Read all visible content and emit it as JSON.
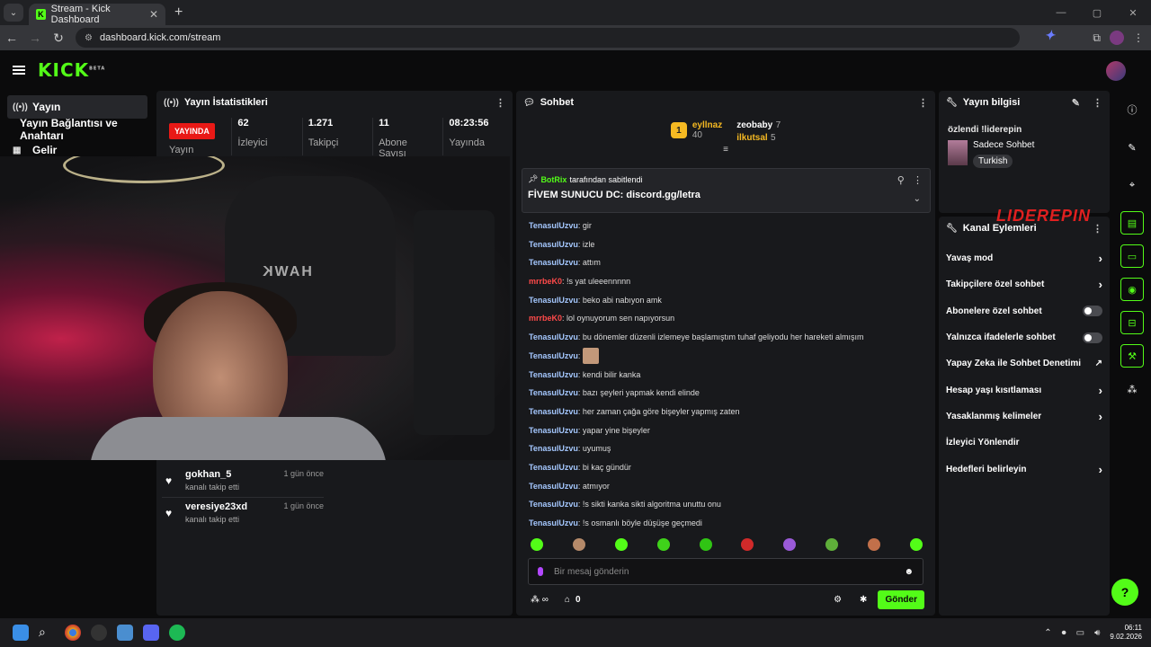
{
  "browser": {
    "tab_title": "Stream - Kick Dashboard",
    "url": "dashboard.kick.com/stream"
  },
  "kick": {
    "logo": "KICK",
    "logo_badge": "BETA"
  },
  "leftnav": {
    "items": [
      {
        "label": "Yayın",
        "icon": "broadcast-icon"
      },
      {
        "label": "Yayın Bağlantısı ve Anahtarı"
      },
      {
        "label": "Gelir",
        "icon": "chart-icon"
      }
    ]
  },
  "stats": {
    "title": "Yayın İstatistikleri",
    "live_badge": "YAYINDA",
    "status_label": "Yayın",
    "items": [
      {
        "value": "62",
        "label": "İzleyici"
      },
      {
        "value": "1.271",
        "label": "Takipçi"
      },
      {
        "value": "11",
        "label": "Abone Sayısı"
      },
      {
        "value": "08:23:56",
        "label": "Yayında"
      }
    ]
  },
  "followers": [
    {
      "name": "gokhan_5",
      "action": "kanalı takip etti",
      "time": "1 gün önce"
    },
    {
      "name": "veresiye23xd",
      "action": "kanalı takip etti",
      "time": "1 gün önce"
    }
  ],
  "chat": {
    "title": "Sohbet",
    "leaderboard": [
      {
        "rank": "1",
        "name": "eyllnaz",
        "count": "40"
      },
      {
        "name": "zeobaby",
        "count": "7"
      },
      {
        "name": "ilkutsal",
        "count": "5"
      }
    ],
    "pinned": {
      "by_name": "BotRix",
      "by_suffix": "tarafından sabitlendi",
      "message": "FİVEM SUNUCU DC: discord.gg/letra"
    },
    "messages": [
      {
        "user": "TenasulUzvu",
        "text": "gir"
      },
      {
        "user": "TenasulUzvu",
        "text": "izle"
      },
      {
        "user": "TenasulUzvu",
        "text": "attım"
      },
      {
        "user": "mrrbeK0",
        "text": "!s yat uleeennnnn",
        "red": true
      },
      {
        "user": "TenasulUzvu",
        "text": "beko abi nabıyon amk"
      },
      {
        "user": "mrrbeK0",
        "text": "lol oynuyorum sen napıyorsun",
        "red": true
      },
      {
        "user": "TenasulUzvu",
        "text": "bu dönemler düzenli izlemeye başlamıştım tuhaf geliyodu her hareketi almışım"
      },
      {
        "user": "TenasulUzvu",
        "text": "",
        "emote": true
      },
      {
        "user": "TenasulUzvu",
        "text": "kendi bilir kanka"
      },
      {
        "user": "TenasulUzvu",
        "text": "bazı şeyleri yapmak kendi elinde"
      },
      {
        "user": "TenasulUzvu",
        "text": "her zaman çağa göre bişeyler yapmış zaten"
      },
      {
        "user": "TenasulUzvu",
        "text": "yapar yine bişeyler"
      },
      {
        "user": "TenasulUzvu",
        "text": "uyumuş"
      },
      {
        "user": "TenasulUzvu",
        "text": "bi kaç gündür"
      },
      {
        "user": "TenasulUzvu",
        "text": "atmıyor"
      },
      {
        "user": "TenasulUzvu",
        "text": "!s sikti kanka sikti algoritma unuttu onu"
      },
      {
        "user": "TenasulUzvu",
        "text": "!s osmanlı böyle düşüşe geçmedi"
      }
    ],
    "input_placeholder": "Bir mesaj gönderin",
    "points": "0",
    "send_label": "Gönder"
  },
  "stream_info": {
    "title": "Yayın bilgisi",
    "stream_title": "özlendi !liderepin",
    "category": "Sadece Sohbet",
    "tag": "Turkish"
  },
  "channel_actions": {
    "title": "Kanal Eylemleri",
    "items": [
      {
        "label": "Yavaş mod",
        "kind": "chevron"
      },
      {
        "label": "Takipçilere özel sohbet",
        "kind": "chevron"
      },
      {
        "label": "Abonelere özel sohbet",
        "kind": "toggle",
        "on": false
      },
      {
        "label": "Yalnızca ifadelerle sohbet",
        "kind": "toggle",
        "on": false
      },
      {
        "label": "Yapay Zeka ile Sohbet Denetimi",
        "kind": "external"
      },
      {
        "label": "Hesap yaşı kısıtlaması",
        "kind": "chevron"
      },
      {
        "label": "Yasaklanmış kelimeler",
        "kind": "chevron"
      },
      {
        "label": "İzleyici Yönlendir",
        "kind": "none"
      },
      {
        "label": "Hedefleri belirleyin",
        "kind": "chevron"
      }
    ]
  },
  "overlay_logo": "LIDEREPIN",
  "taskbar": {
    "time": "06:11",
    "date": "9.02.2026"
  },
  "colors": {
    "accent": "#53fc18",
    "live": "#e91916",
    "username": "#a5c8ff",
    "username_red": "#ff4a4a"
  }
}
